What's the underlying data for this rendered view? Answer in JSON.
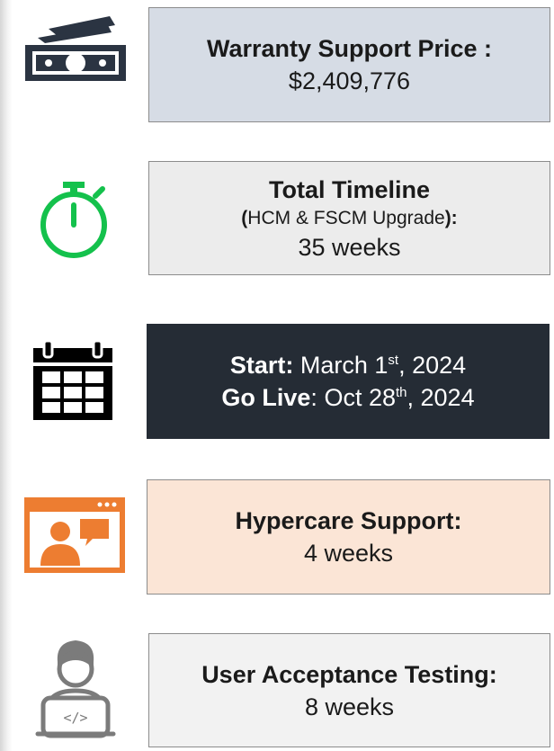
{
  "colors": {
    "card_price": "#d6dce5",
    "card_timeline": "#ececec",
    "card_dates": "#252c35",
    "card_hypercare": "#fbe5d6",
    "card_uat": "#f2f2f2",
    "icon_dark": "#2b3442",
    "icon_green": "#14c14c",
    "icon_orange": "#ed7d31",
    "icon_gray": "#7b7b7b"
  },
  "icons": {
    "money": "cash-icon",
    "timer": "stopwatch-icon",
    "calendar": "calendar-icon",
    "presentation": "video-presenter-icon",
    "developer": "developer-laptop-icon"
  },
  "warranty": {
    "label": "Warranty Support Price :",
    "value": "$2,409,776"
  },
  "timeline": {
    "label": "Total Timeline",
    "paren_open": "(",
    "scope": "HCM & FSCM Upgrade",
    "paren_close": "):",
    "value": "35 weeks"
  },
  "dates": {
    "start_label": "Start:",
    "start_value_pre": "March 1",
    "start_sup": "st",
    "start_value_post": ", 2024",
    "golive_label": "Go Live",
    "golive_colon": ":",
    "golive_value_pre": "Oct 28",
    "golive_sup": "th",
    "golive_value_post": ", 2024"
  },
  "hypercare": {
    "label": "Hypercare Support:",
    "value": "4 weeks"
  },
  "uat": {
    "label": "User Acceptance Testing:",
    "value": "8 weeks",
    "code_glyph": "</>"
  }
}
